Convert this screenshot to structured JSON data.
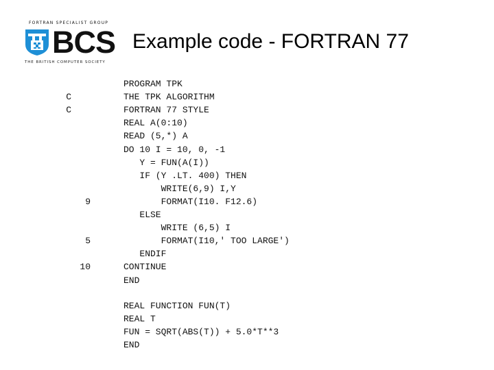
{
  "logo": {
    "top_text": "FORTRAN SPECIALIST GROUP",
    "name": "BCS",
    "bottom_text": "THE BRITISH COMPUTER SOCIETY",
    "icon": "bcs-shield-icon",
    "brand_color": "#1e8fd6"
  },
  "title": "Example code - FORTRAN 77",
  "code": {
    "main_program": [
      {
        "label": "",
        "text": "PROGRAM TPK"
      },
      {
        "label": "C",
        "text": "THE TPK ALGORITHM"
      },
      {
        "label": "C",
        "text": "FORTRAN 77 STYLE"
      },
      {
        "label": "",
        "text": "REAL A(0:10)"
      },
      {
        "label": "",
        "text": "READ (5,*) A"
      },
      {
        "label": "",
        "text": "DO 10 I = 10, 0, -1"
      },
      {
        "label": "",
        "text": "   Y = FUN(A(I))"
      },
      {
        "label": "",
        "text": "   IF (Y .LT. 400) THEN"
      },
      {
        "label": "",
        "text": "       WRITE(6,9) I,Y"
      },
      {
        "label": "9",
        "text": "       FORMAT(I10. F12.6)"
      },
      {
        "label": "",
        "text": "   ELSE"
      },
      {
        "label": "",
        "text": "       WRITE (6,5) I"
      },
      {
        "label": "5",
        "text": "       FORMAT(I10,' TOO LARGE')"
      },
      {
        "label": "",
        "text": "   ENDIF"
      },
      {
        "label": "10",
        "text": "CONTINUE"
      },
      {
        "label": "",
        "text": "END"
      }
    ],
    "function": [
      {
        "label": "",
        "text": "REAL FUNCTION FUN(T)"
      },
      {
        "label": "",
        "text": "REAL T"
      },
      {
        "label": "",
        "text": "FUN = SQRT(ABS(T)) + 5.0*T**3"
      },
      {
        "label": "",
        "text": "END"
      }
    ]
  }
}
